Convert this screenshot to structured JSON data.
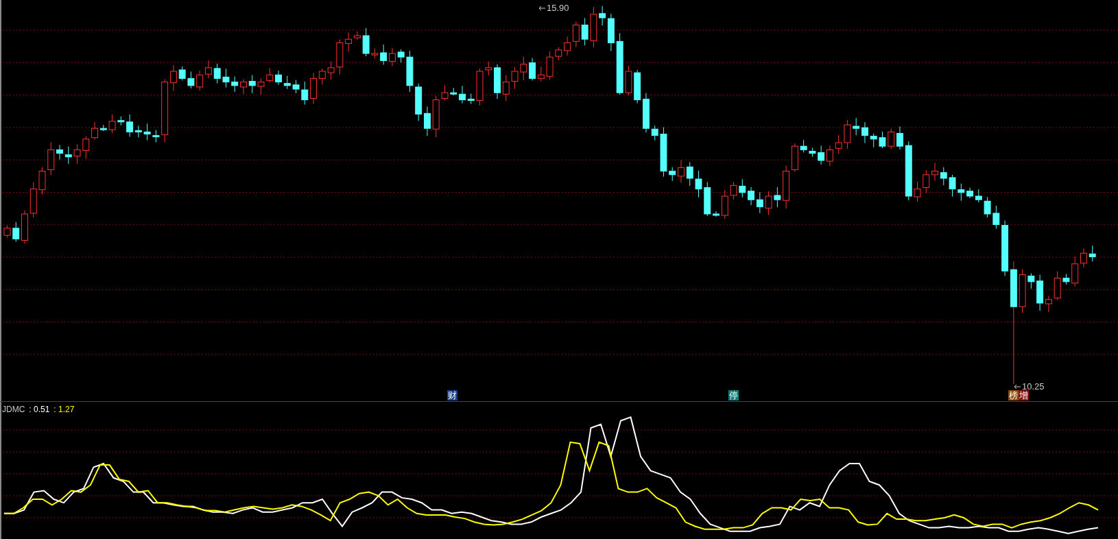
{
  "price_panel": {
    "high_label": "15.90",
    "low_label": "10.25",
    "event_tags": [
      {
        "text": "财",
        "color": "#1c3f8c"
      },
      {
        "text": "停",
        "color": "#0d7c7c"
      },
      {
        "text": "榜",
        "color": "#8a4b0c"
      },
      {
        "text": "增",
        "color": "#8c1212"
      }
    ]
  },
  "indicator_panel": {
    "name": "JDMC",
    "values": [
      {
        "text": ": 0.51",
        "color": "#ffffff"
      },
      {
        "text": ": 1.27",
        "color": "#ffff00"
      }
    ]
  }
}
